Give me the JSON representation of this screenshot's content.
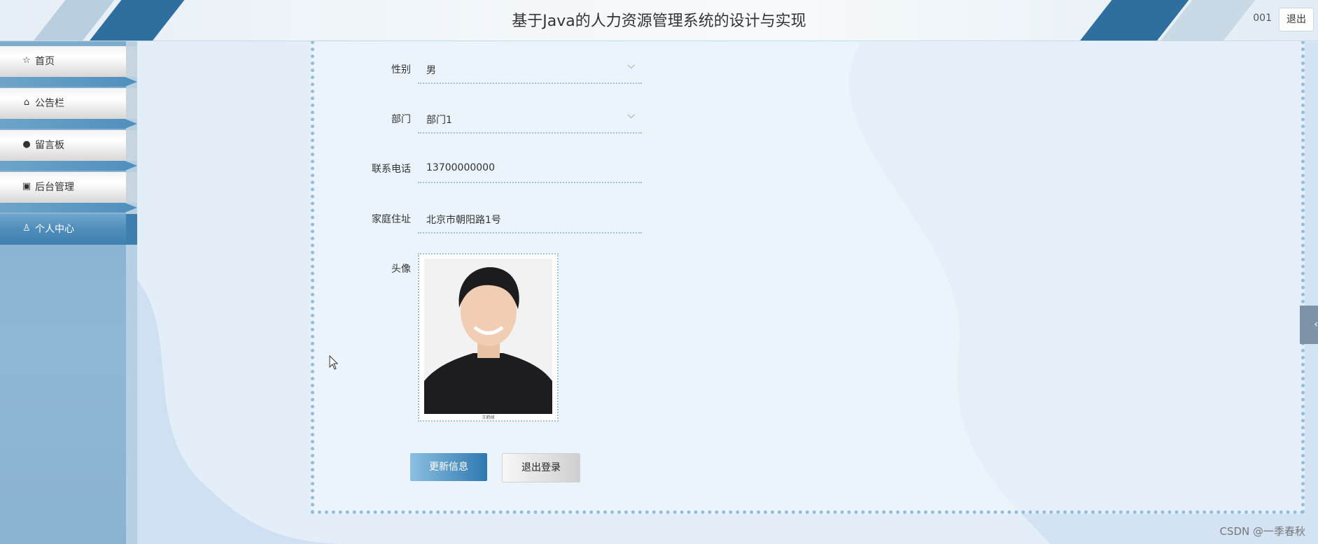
{
  "header": {
    "title": "基于Java的人力资源管理系统的设计与实现",
    "username": "001",
    "logout_label": "退出"
  },
  "sidebar": {
    "items": [
      {
        "label": "首页",
        "icon": "star-icon"
      },
      {
        "label": "公告栏",
        "icon": "bag-icon"
      },
      {
        "label": "留言板",
        "icon": "alert-icon"
      },
      {
        "label": "后台管理",
        "icon": "briefcase-icon"
      },
      {
        "label": "个人中心",
        "icon": "user-icon",
        "active": true
      }
    ]
  },
  "form": {
    "gender": {
      "label": "性别",
      "value": "男"
    },
    "department": {
      "label": "部门",
      "value": "部门1"
    },
    "phone": {
      "label": "联系电话",
      "value": "13700000000"
    },
    "address": {
      "label": "家庭住址",
      "value": "北京市朝阳路1号"
    },
    "avatar": {
      "label": "头像",
      "caption": "王鹤棣"
    }
  },
  "buttons": {
    "update": "更新信息",
    "logout": "退出登录"
  },
  "side_tab": {
    "icon": "chevron-left-icon",
    "glyph": "‹"
  },
  "watermark": "CSDN @一季春秋",
  "colors": {
    "accent": "#3f7fb0",
    "sidebar": "#8ab3d1",
    "frame_dots": "#8fbfdc"
  }
}
